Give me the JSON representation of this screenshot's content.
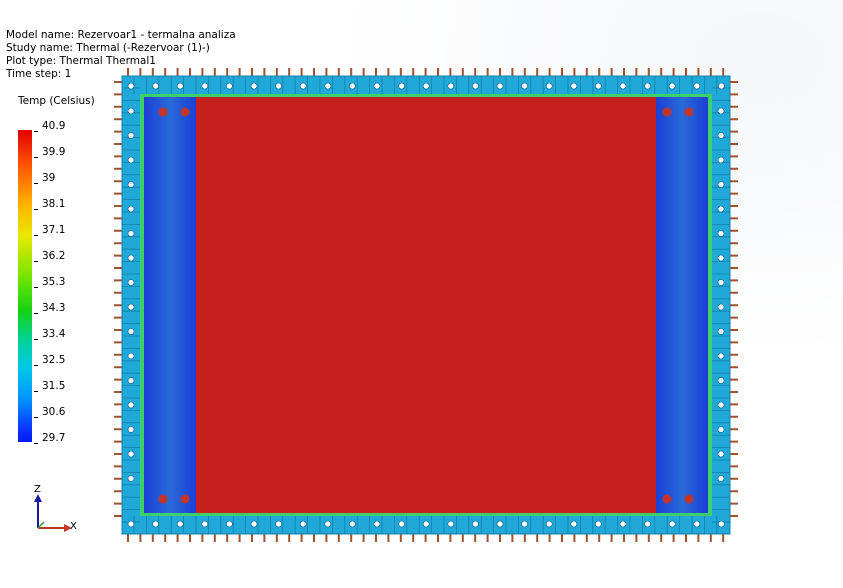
{
  "info": {
    "model_name": "Model name: Rezervoar1 - termalna analiza",
    "study_name": "Study name: Thermal (-Rezervoar (1)-)",
    "plot_type": "Plot type: Thermal Thermal1",
    "time_step": "Time step: 1"
  },
  "legend": {
    "title": "Temp (Celsius)",
    "ticks": [
      "40.9",
      "39.9",
      "39",
      "38.1",
      "37.1",
      "36.2",
      "35.3",
      "34.3",
      "33.4",
      "32.5",
      "31.5",
      "30.6",
      "29.7"
    ]
  },
  "triad": {
    "z_label": "Z",
    "x_label": "X"
  },
  "colors": {
    "hot": "#c71f1e",
    "cold": "#1832d2",
    "frame": "#22a6d4",
    "pipe": "#a0522d"
  }
}
